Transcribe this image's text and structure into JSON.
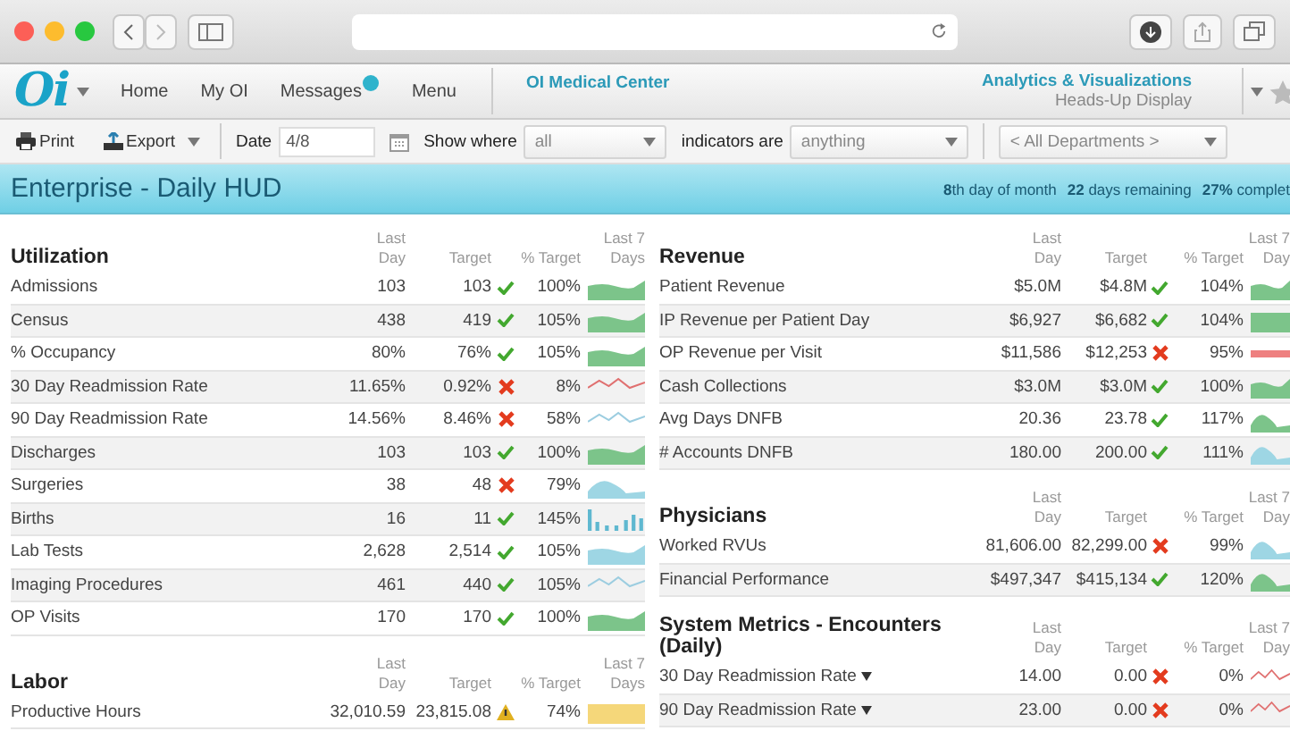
{
  "nav": {
    "logo": "Oi",
    "items": [
      {
        "label": "Home",
        "badge": false
      },
      {
        "label": "My OI",
        "badge": false
      },
      {
        "label": "Messages",
        "badge": true
      },
      {
        "label": "Menu",
        "badge": false
      }
    ],
    "center": "OI Medical Center",
    "product": "Analytics & Visualizations",
    "subtitle": "Heads-Up Display"
  },
  "toolbar": {
    "print": "Print",
    "export": "Export",
    "date_label": "Date",
    "date_value": "4/8",
    "show_where_label": "Show where",
    "show_where_value": "all",
    "indicators_label": "indicators are",
    "indicators_value": "anything",
    "department": "< All Departments >"
  },
  "header": {
    "title": "Enterprise - Daily HUD",
    "progress": [
      "**8**th day of month",
      "**22** days remaining",
      "**27%** complet"
    ]
  },
  "columns": [
    {
      "sections": [
        {
          "title": "Utilization",
          "headers": [
            "Last Day",
            "Target",
            "% Target",
            "Last 7 Days"
          ],
          "rows": [
            {
              "name": "Admissions",
              "dropdown": false,
              "last_day": "103",
              "target": "103",
              "kind": "ok",
              "pct": "100%",
              "trend": {
                "kind": "area",
                "color": "#7cc48a"
              }
            },
            {
              "name": "Census",
              "dropdown": false,
              "last_day": "438",
              "target": "419",
              "kind": "ok",
              "pct": "105%",
              "trend": {
                "kind": "area",
                "color": "#7cc48a"
              }
            },
            {
              "name": "% Occupancy",
              "dropdown": false,
              "last_day": "80%",
              "target": "76%",
              "kind": "ok",
              "pct": "105%",
              "trend": {
                "kind": "area",
                "color": "#7cc48a"
              }
            },
            {
              "name": "30 Day Readmission Rate",
              "dropdown": false,
              "last_day": "11.65%",
              "target": "0.92%",
              "kind": "bad",
              "pct": "8%",
              "trend": {
                "kind": "line",
                "color": "#e07070"
              }
            },
            {
              "name": "90 Day Readmission Rate",
              "dropdown": false,
              "last_day": "14.56%",
              "target": "8.46%",
              "kind": "bad",
              "pct": "58%",
              "trend": {
                "kind": "line",
                "color": "#9ccde0"
              }
            },
            {
              "name": "Discharges",
              "dropdown": false,
              "last_day": "103",
              "target": "103",
              "kind": "ok",
              "pct": "100%",
              "trend": {
                "kind": "area",
                "color": "#7cc48a"
              }
            },
            {
              "name": "Surgeries",
              "dropdown": false,
              "last_day": "38",
              "target": "48",
              "kind": "bad",
              "pct": "79%",
              "trend": {
                "kind": "hill",
                "color": "#9ed6e4"
              }
            },
            {
              "name": "Births",
              "dropdown": false,
              "last_day": "16",
              "target": "11",
              "kind": "ok",
              "pct": "145%",
              "trend": {
                "kind": "bars",
                "color": "#5fb8d0"
              }
            },
            {
              "name": "Lab Tests",
              "dropdown": false,
              "last_day": "2,628",
              "target": "2,514",
              "kind": "ok",
              "pct": "105%",
              "trend": {
                "kind": "area",
                "color": "#9ed6e4"
              }
            },
            {
              "name": "Imaging Procedures",
              "dropdown": false,
              "last_day": "461",
              "target": "440",
              "kind": "ok",
              "pct": "105%",
              "trend": {
                "kind": "line",
                "color": "#9ccde0"
              }
            },
            {
              "name": "OP Visits",
              "dropdown": false,
              "last_day": "170",
              "target": "170",
              "kind": "ok",
              "pct": "100%",
              "trend": {
                "kind": "area",
                "color": "#7cc48a"
              }
            }
          ]
        },
        {
          "title": "Labor",
          "headers": [
            "Last Day",
            "Target",
            "% Target",
            "Last 7 Days"
          ],
          "rows": [
            {
              "name": "Productive Hours",
              "dropdown": false,
              "last_day": "32,010.59",
              "target": "23,815.08",
              "kind": "warn",
              "pct": "74%",
              "trend": {
                "kind": "band",
                "color": "#f5d77a"
              }
            }
          ]
        }
      ]
    },
    {
      "sections": [
        {
          "title": "Revenue",
          "headers": [
            "Last Day",
            "Target",
            "% Target",
            "Last 7 Day"
          ],
          "rows": [
            {
              "name": "Patient Revenue",
              "dropdown": false,
              "last_day": "$5.0M",
              "target": "$4.8M",
              "kind": "ok",
              "pct": "104%",
              "trend": {
                "kind": "area",
                "color": "#7cc48a"
              }
            },
            {
              "name": "IP Revenue per Patient Day",
              "dropdown": false,
              "last_day": "$6,927",
              "target": "$6,682",
              "kind": "ok",
              "pct": "104%",
              "trend": {
                "kind": "band",
                "color": "#7cc48a"
              }
            },
            {
              "name": "OP Revenue per Visit",
              "dropdown": false,
              "last_day": "$11,586",
              "target": "$12,253",
              "kind": "bad",
              "pct": "95%",
              "trend": {
                "kind": "thin",
                "color": "#ee8080"
              }
            },
            {
              "name": "Cash Collections",
              "dropdown": false,
              "last_day": "$3.0M",
              "target": "$3.0M",
              "kind": "ok",
              "pct": "100%",
              "trend": {
                "kind": "area",
                "color": "#7cc48a"
              }
            },
            {
              "name": "Avg Days DNFB",
              "dropdown": false,
              "last_day": "20.36",
              "target": "23.78",
              "kind": "ok",
              "pct": "117%",
              "trend": {
                "kind": "hill",
                "color": "#7cc48a"
              }
            },
            {
              "name": "# Accounts DNFB",
              "dropdown": false,
              "last_day": "180.00",
              "target": "200.00",
              "kind": "ok",
              "pct": "111%",
              "trend": {
                "kind": "hill",
                "color": "#9ed6e4"
              }
            }
          ]
        },
        {
          "title": "Physicians",
          "headers": [
            "Last Day",
            "Target",
            "% Target",
            "Last 7 Day"
          ],
          "rows": [
            {
              "name": "Worked RVUs",
              "dropdown": false,
              "last_day": "81,606.00",
              "target": "82,299.00",
              "kind": "bad",
              "pct": "99%",
              "trend": {
                "kind": "hill",
                "color": "#9ed6e4"
              }
            },
            {
              "name": "Financial Performance",
              "dropdown": false,
              "last_day": "$497,347",
              "target": "$415,134",
              "kind": "ok",
              "pct": "120%",
              "trend": {
                "kind": "hill",
                "color": "#7cc48a"
              }
            }
          ]
        },
        {
          "title": "System Metrics - Encounters (Daily)",
          "headers": [
            "Last Day",
            "Target",
            "% Target",
            "Last 7 Day"
          ],
          "rows": [
            {
              "name": "30 Day Readmission Rate",
              "dropdown": true,
              "last_day": "14.00",
              "target": "0.00",
              "kind": "bad",
              "pct": "0%",
              "trend": {
                "kind": "line",
                "color": "#e07070"
              }
            },
            {
              "name": "90 Day Readmission Rate",
              "dropdown": true,
              "last_day": "23.00",
              "target": "0.00",
              "kind": "bad",
              "pct": "0%",
              "trend": {
                "kind": "line",
                "color": "#e07070"
              }
            }
          ]
        }
      ]
    }
  ]
}
